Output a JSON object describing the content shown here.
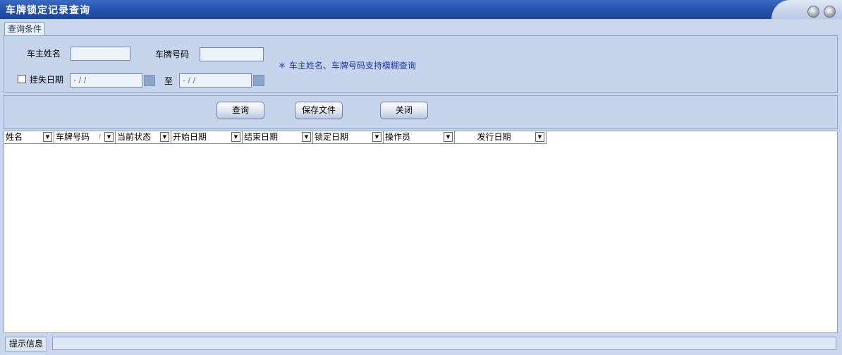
{
  "window": {
    "title": "车牌锁定记录查询"
  },
  "tab": {
    "label": "查询条件"
  },
  "filters": {
    "owner_name_label": "车主姓名",
    "owner_name_value": "",
    "plate_label": "车牌号码",
    "plate_value": "",
    "lost_date_label": "挂失日期",
    "lost_date_checked": false,
    "date_from": "- / /",
    "to_label": "至",
    "date_to": "- / /",
    "hint": "＊ 车主姓名、车牌号码支持模糊查询"
  },
  "buttons": {
    "query": "查询",
    "save_file": "保存文件",
    "close": "关闭"
  },
  "table": {
    "columns": [
      {
        "label": "姓名"
      },
      {
        "label": "车牌号码",
        "sort_mark": "/"
      },
      {
        "label": "当前状态"
      },
      {
        "label": "开始日期"
      },
      {
        "label": "结束日期"
      },
      {
        "label": "锁定日期"
      },
      {
        "label": "操作员"
      },
      {
        "label": "发行日期",
        "centered": true
      }
    ],
    "rows": []
  },
  "statusbar": {
    "label": "提示信息",
    "message": ""
  },
  "colors": {
    "title_bar": "#2350a8",
    "panel": "#c6d5ec",
    "hint_text": "#1a33b5"
  }
}
